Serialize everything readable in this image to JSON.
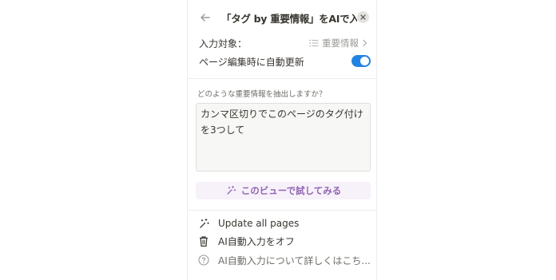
{
  "header": {
    "title": "「タグ by 重要情報」をAIで入力"
  },
  "settings": {
    "target_label": "入力対象：",
    "target_value": "重要情報",
    "auto_update_label": "ページ編集時に自動更新",
    "auto_update_on": true
  },
  "prompt": {
    "question": "どのような重要情報を抽出しますか？",
    "value": "カンマ区切りでこのページのタグ付けを3つして"
  },
  "try_button": {
    "label": "このビューで試してみる"
  },
  "menu": {
    "update_all": "Update all pages",
    "turn_off": "AI自動入力をオフ",
    "learn_more": "AI自動入力について詳しくはこち..."
  },
  "colors": {
    "accent": "#2383e2",
    "ai_purple": "#9065b0",
    "ai_purple_bg": "#f7f1fa"
  }
}
